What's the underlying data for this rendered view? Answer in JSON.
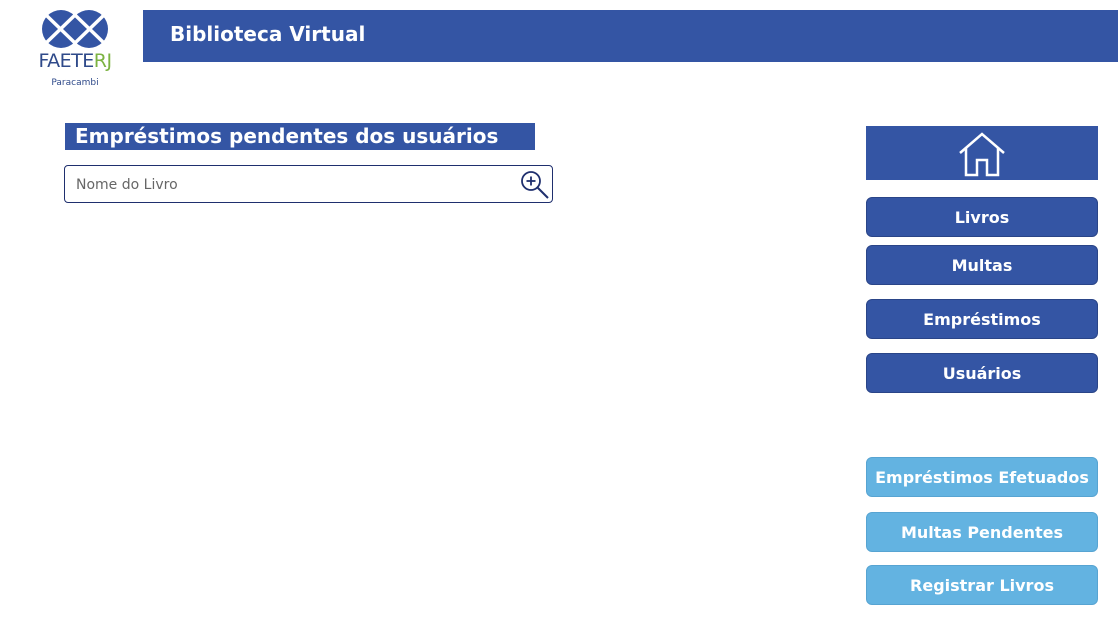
{
  "logo": {
    "name_main": "FAETE",
    "name_accent": "RJ",
    "subtitle": "Paracambi"
  },
  "header": {
    "title": "Biblioteca Virtual"
  },
  "main": {
    "section_title": "Empréstimos pendentes dos usuários",
    "search": {
      "placeholder": "Nome do Livro",
      "value": ""
    }
  },
  "sidebar": {
    "home_icon": "home-icon",
    "primary": [
      {
        "label": "Livros"
      },
      {
        "label": "Multas"
      },
      {
        "label": "Empréstimos"
      },
      {
        "label": "Usuários"
      }
    ],
    "secondary": [
      {
        "label": "Empréstimos Efetuados"
      },
      {
        "label": "Multas Pendentes"
      },
      {
        "label": "Registrar Livros"
      }
    ]
  },
  "colors": {
    "primary": "#3455a4",
    "secondary": "#63b3e1",
    "accent_green": "#7cb342"
  }
}
